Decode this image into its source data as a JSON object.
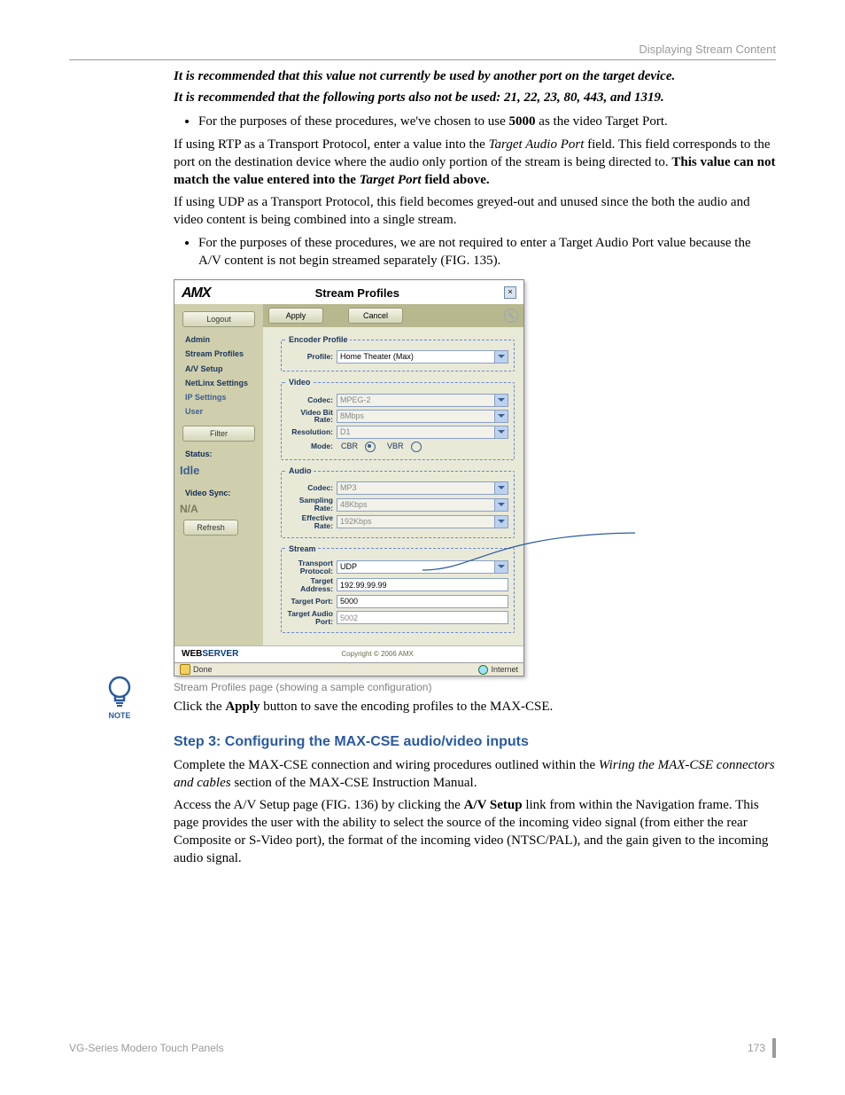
{
  "header": {
    "running": "Displaying Stream Content"
  },
  "intro": {
    "rec1": "It is recommended that this value not currently be used by another port on the target device.",
    "rec2": "It is recommended that the following ports also not be used: 21, 22, 23, 80, 443, and 1319.",
    "bullet1_a": "For the purposes of these procedures, we've chosen to use ",
    "bullet1_b": "5000",
    "bullet1_c": " as the video Target Port.",
    "p1_a": "If using RTP as a Transport Protocol, enter a value into the ",
    "p1_b": "Target Audio Port",
    "p1_c": " field. This field corresponds to the port on the destination device where the audio only portion of the stream is being directed to. ",
    "p1_d": "This value can not match the value entered into the ",
    "p1_e": "Target Port",
    "p1_f": " field above.",
    "p2": "If using UDP as a Transport Protocol, this field becomes greyed-out and unused since the both the audio and video content is being combined into a single stream.",
    "bullet2": "For the purposes of these procedures, we are not required to enter a Target Audio Port value because the A/V content is not begin streamed separately (FIG. 135)."
  },
  "screenshot": {
    "logo": "AMX",
    "title": "Stream Profiles",
    "close": "×",
    "sidebar": {
      "logout": "Logout",
      "links": [
        "Admin",
        "Stream Profiles",
        "A/V Setup",
        "NetLinx Settings",
        "IP Settings",
        "User"
      ],
      "filter": "Filter",
      "status_label": "Status:",
      "status_value": "Idle",
      "vsync_label": "Video Sync:",
      "vsync_value": "N/A",
      "refresh": "Refresh"
    },
    "toolbar": {
      "apply": "Apply",
      "cancel": "Cancel"
    },
    "encoder": {
      "legend": "Encoder Profile",
      "profile_label": "Profile:",
      "profile_value": "Home Theater (Max)"
    },
    "video": {
      "legend": "Video",
      "codec_label": "Codec:",
      "codec_value": "MPEG-2",
      "bitrate_label": "Video Bit Rate:",
      "bitrate_value": "8Mbps",
      "res_label": "Resolution:",
      "res_value": "D1",
      "mode_label": "Mode:",
      "mode_cbr": "CBR",
      "mode_vbr": "VBR"
    },
    "audio": {
      "legend": "Audio",
      "codec_label": "Codec:",
      "codec_value": "MP3",
      "samp_label": "Sampling Rate:",
      "samp_value": "48Kbps",
      "eff_label": "Effective Rate:",
      "eff_value": "192Kbps"
    },
    "stream": {
      "legend": "Stream",
      "proto_label": "Transport Protocol:",
      "proto_value": "UDP",
      "addr_label": "Target Address:",
      "addr_value": "192.99.99.99",
      "port_label": "Target Port:",
      "port_value": "5000",
      "aport_label": "Target Audio Port:",
      "aport_value": "5002"
    },
    "copyright": "Copyright © 2006 AMX",
    "webserver_pre": "WEB",
    "webserver_suf": "SERVER",
    "status_done": "Done",
    "status_net": "Internet"
  },
  "caption": "Stream Profiles page (showing a sample configuration)",
  "click_apply_a": "Click the ",
  "click_apply_b": "Apply",
  "click_apply_c": " button to save the encoding profiles to the MAX-CSE.",
  "note_label": "NOTE",
  "step3": {
    "heading": "Step 3: Configuring the MAX-CSE audio/video inputs",
    "p1_a": "Complete the MAX-CSE connection and wiring procedures outlined within the ",
    "p1_b": "Wiring the MAX-CSE connectors and cables",
    "p1_c": " section of the MAX-CSE Instruction Manual.",
    "p2_a": "Access the A/V Setup page (FIG. 136) by clicking the ",
    "p2_b": "A/V Setup",
    "p2_c": " link from within the Navigation frame. This page provides the user with the ability to select the source of the incoming video signal (from either the rear Composite or S-Video port), the format of the incoming video (NTSC/PAL), and the gain given to the incoming audio signal."
  },
  "footer": {
    "left": "VG-Series Modero Touch Panels",
    "page": "173"
  }
}
